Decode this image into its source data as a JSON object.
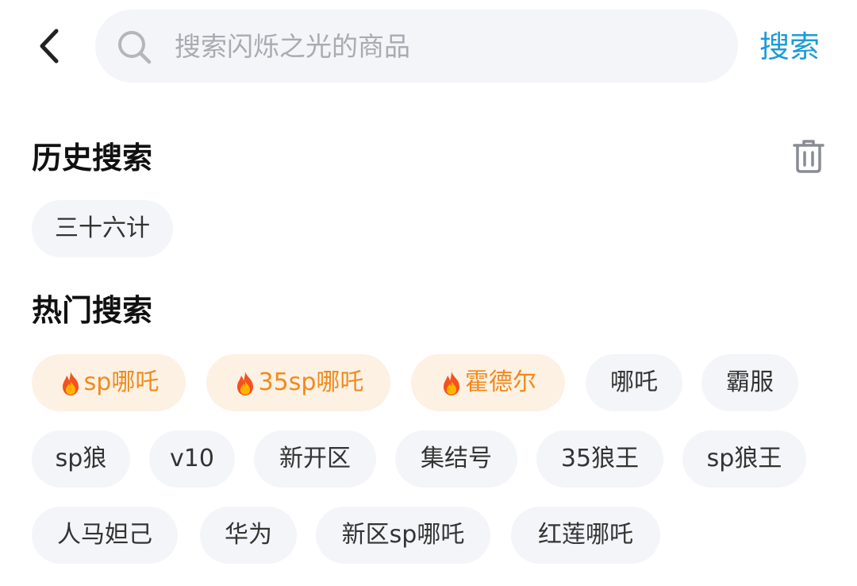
{
  "search": {
    "placeholder": "搜索闪烁之光的商品",
    "value": "",
    "button_label": "搜索"
  },
  "history": {
    "title": "历史搜索",
    "items": [
      "三十六计"
    ]
  },
  "hot": {
    "title": "热门搜索",
    "rows": [
      [
        {
          "label": "sp哪吒",
          "hot": true
        },
        {
          "label": "35sp哪吒",
          "hot": true
        },
        {
          "label": "霍德尔",
          "hot": true
        },
        {
          "label": "哪吒",
          "hot": false
        },
        {
          "label": "霸服",
          "hot": false
        }
      ],
      [
        {
          "label": "sp狼",
          "hot": false
        },
        {
          "label": "v10",
          "hot": false
        },
        {
          "label": "新开区",
          "hot": false
        },
        {
          "label": "集结号",
          "hot": false
        },
        {
          "label": "35狼王",
          "hot": false
        },
        {
          "label": "sp狼王",
          "hot": false
        }
      ],
      [
        {
          "label": "人马妲己",
          "hot": false
        },
        {
          "label": "华为",
          "hot": false
        },
        {
          "label": "新区sp哪吒",
          "hot": false
        },
        {
          "label": "红莲哪吒",
          "hot": false
        }
      ]
    ]
  },
  "icons": {
    "back": "chevron-left-icon",
    "search": "search-icon",
    "trash": "trash-icon",
    "fire": "fire-icon"
  },
  "colors": {
    "accent": "#1d9bd8",
    "hot_text": "#f08a1c",
    "hot_bg": "#fdf1e4",
    "chip_bg": "#f4f5f8"
  }
}
